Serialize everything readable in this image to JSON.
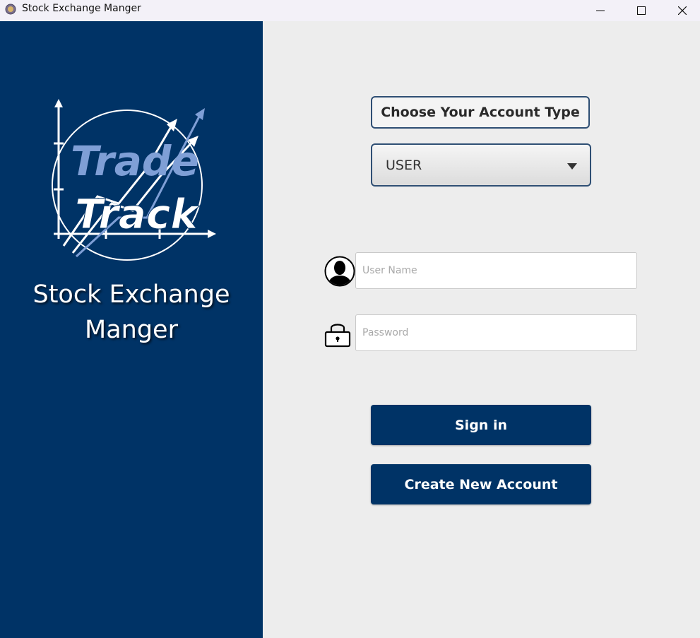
{
  "window": {
    "title": "Stock Exchange Manger",
    "icons": [
      "app-icon",
      "minimize-icon",
      "maximize-icon",
      "close-icon"
    ]
  },
  "branding": {
    "logo_line1": "Trade",
    "logo_line2": "Track",
    "app_name_line1": "Stock Exchange",
    "app_name_line2": "Manger"
  },
  "login": {
    "account_type_label": "Choose Your  Account Type",
    "account_type_selected": "USER",
    "username_placeholder": "User Name",
    "username_value": "",
    "password_placeholder": "Password",
    "password_value": "",
    "sign_in_label": "Sign in",
    "create_account_label": "Create New Account"
  },
  "colors": {
    "primary": "#003366",
    "panel_background": "#ededed",
    "border": "#2f4f74"
  }
}
